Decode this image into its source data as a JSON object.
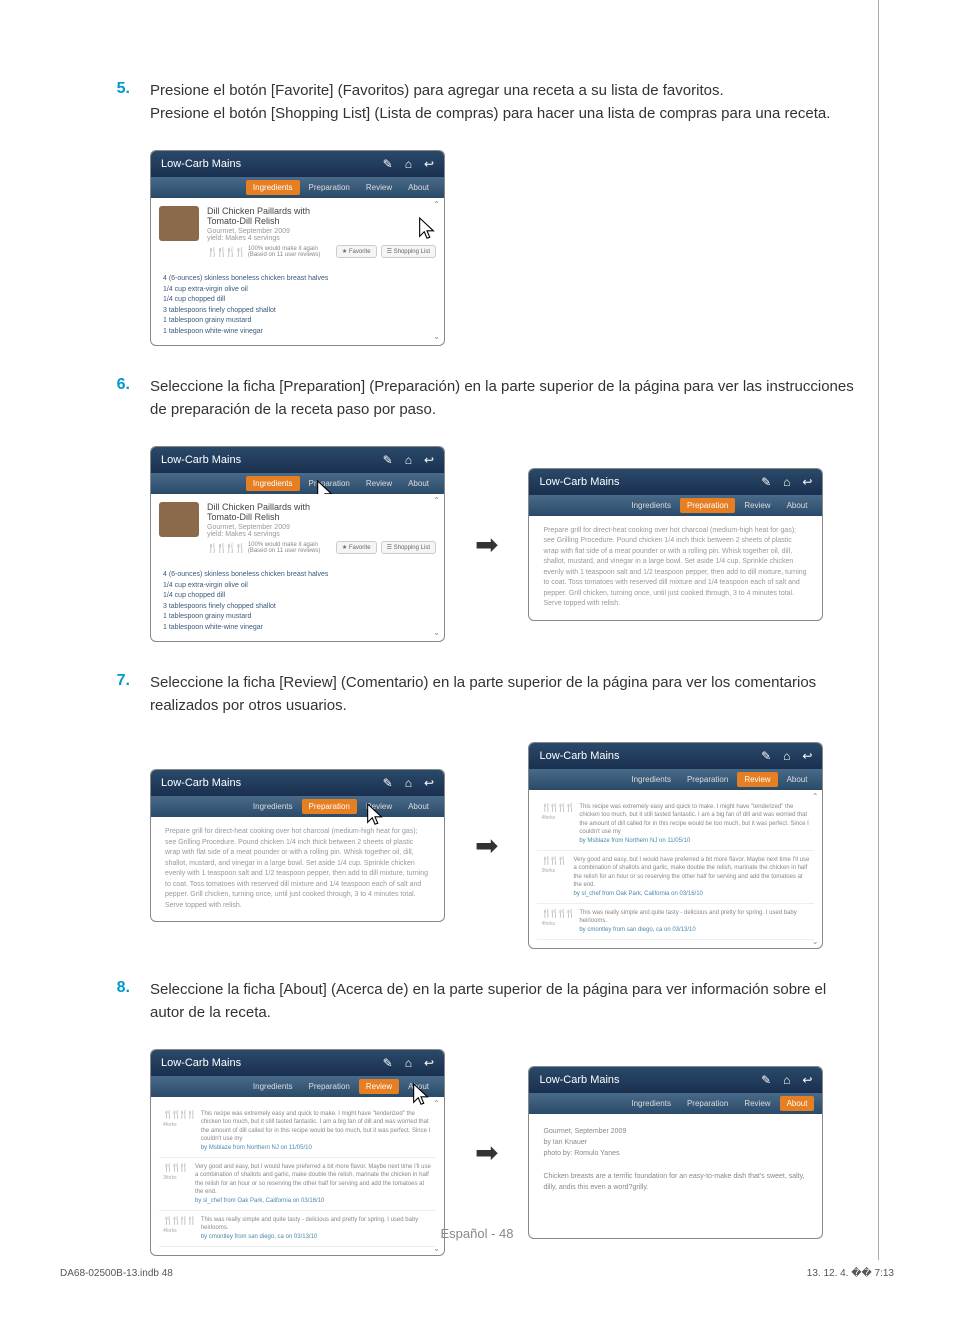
{
  "steps": {
    "5": {
      "num": "5.",
      "text_a": "Presione el botón [Favorite] (Favoritos) para agregar una receta a su lista de favoritos.",
      "text_b": "Presione el botón [Shopping List] (Lista de compras) para hacer una lista de compras para una receta."
    },
    "6": {
      "num": "6.",
      "text": "Seleccione la ficha [Preparation] (Preparación) en la parte superior de la página para ver las instrucciones de preparación de la receta paso por paso."
    },
    "7": {
      "num": "7.",
      "text": "Seleccione la ficha [Review] (Comentario) en la parte superior de la página para ver los comentarios realizados por otros usuarios."
    },
    "8": {
      "num": "8.",
      "text": "Seleccione la ficha [About] (Acerca de) en la parte superior de la página para ver información sobre el autor de la receta."
    }
  },
  "app": {
    "title": "Low-Carb Mains",
    "tabs": {
      "ingredients": "Ingredients",
      "preparation": "Preparation",
      "review": "Review",
      "about": "About"
    },
    "recipe": {
      "title": "Dill Chicken Paillards with Tomato-Dill Relish",
      "source": "Gourmet, September 2009",
      "yield": "yield: Makes 4 servings",
      "rating": "100% would make it again",
      "rating_sub": "(Based on 11 user reviews)",
      "btn_fav": "Favorite",
      "btn_shop": "Shopping List"
    },
    "ingredients": [
      "4 (6-ounces) skinless boneless chicken breast halves",
      "1/4 cup extra-virgin olive oil",
      "1/4 cup chopped dill",
      "3 tablespoons finely chopped shallot",
      "1 tablespoon grainy mustard",
      "1 tablespoon white-wine vinegar"
    ],
    "preparation": "Prepare grill for direct-heat cooking over hot charcoal (medium-high heat for gas); see Grilling Procedure. Pound chicken 1/4 inch thick between 2 sheets of plastic wrap with flat side of a meat pounder or with a rolling pin. Whisk together oil, dill, shallot, mustard, and vinegar in a large bowl. Set aside 1/4 cup. Sprinkle chicken evenly with 1 teaspoon salt and 1/2 teaspoon pepper, then add to dill mixture, turning to coat. Toss tomatoes with reserved dill mixture and 1/4 teaspoon each of salt and pepper. Grill chicken, turning once, until just cooked through, 3 to 4 minutes total. Serve topped with relish.",
    "reviews": [
      {
        "forks": "4forks",
        "text": "This recipe was extremely easy and quick to make. I might have \"tenderized\" the chicken too much, but it still tasted fantastic. I am a big fan of dill and was worried that the amount of dill called for in this recipe would be too much, but it was perfect. Since I couldn't use my",
        "author": "by Msblaze from Northern NJ on 11/05/10"
      },
      {
        "forks": "3forks",
        "text": "Very good and easy, but I would have preferred a bit more flavor. Maybe next time I'll use a combination of shallots and garlic, make double the relish, marinate the chicken in half the relish for an hour or so reserving the other half for serving and add the tomatoes at the end.",
        "author": "by sl_chef from Oak Park, California on 03/16/10"
      },
      {
        "forks": "4forks",
        "text": "This was really simple and quite tasty - delicious and pretty for spring. I used baby heirlooms.",
        "author": "by cmontley from san diego, ca on 03/13/10"
      }
    ],
    "about": {
      "source": "Gourmet, September 2009",
      "author": "by Ian Knauer",
      "photo": "photo by: Romulo Yanes",
      "desc": "Chicken breasts are a terrific foundation for an easy-to-make dish that's sweet, salty, dilly, andis this even a word?grilly."
    }
  },
  "arrow": "➡",
  "footer": {
    "page": "Español - 48",
    "file": "DA68-02500B-13.indb   48",
    "timestamp": "13. 12. 4.   �� 7:13"
  }
}
